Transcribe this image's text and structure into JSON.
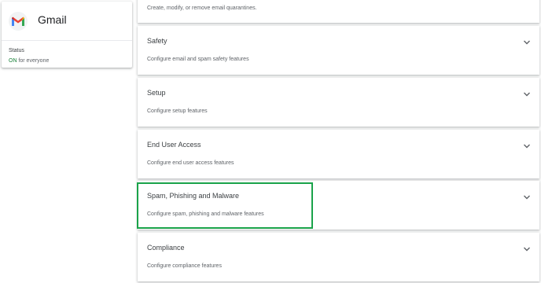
{
  "app": {
    "name": "Gmail",
    "status_label": "Status",
    "status_on": "ON",
    "status_suffix": " for everyone",
    "logo_icon": "gmail-logo-icon"
  },
  "colors": {
    "status_on": "#188038",
    "highlight": "#1aa34a"
  },
  "settings": [
    {
      "title": "",
      "description": "Create, modify, or remove email quarantines."
    },
    {
      "title": "Safety",
      "description": "Configure email and spam safety features"
    },
    {
      "title": "Setup",
      "description": "Configure setup features"
    },
    {
      "title": "End User Access",
      "description": "Configure end user access features"
    },
    {
      "title": "Spam, Phishing and Malware",
      "description": "Configure spam, phishing and malware features"
    },
    {
      "title": "Compliance",
      "description": "Configure compliance features"
    }
  ],
  "icons": {
    "expand": "chevron-down-icon"
  }
}
